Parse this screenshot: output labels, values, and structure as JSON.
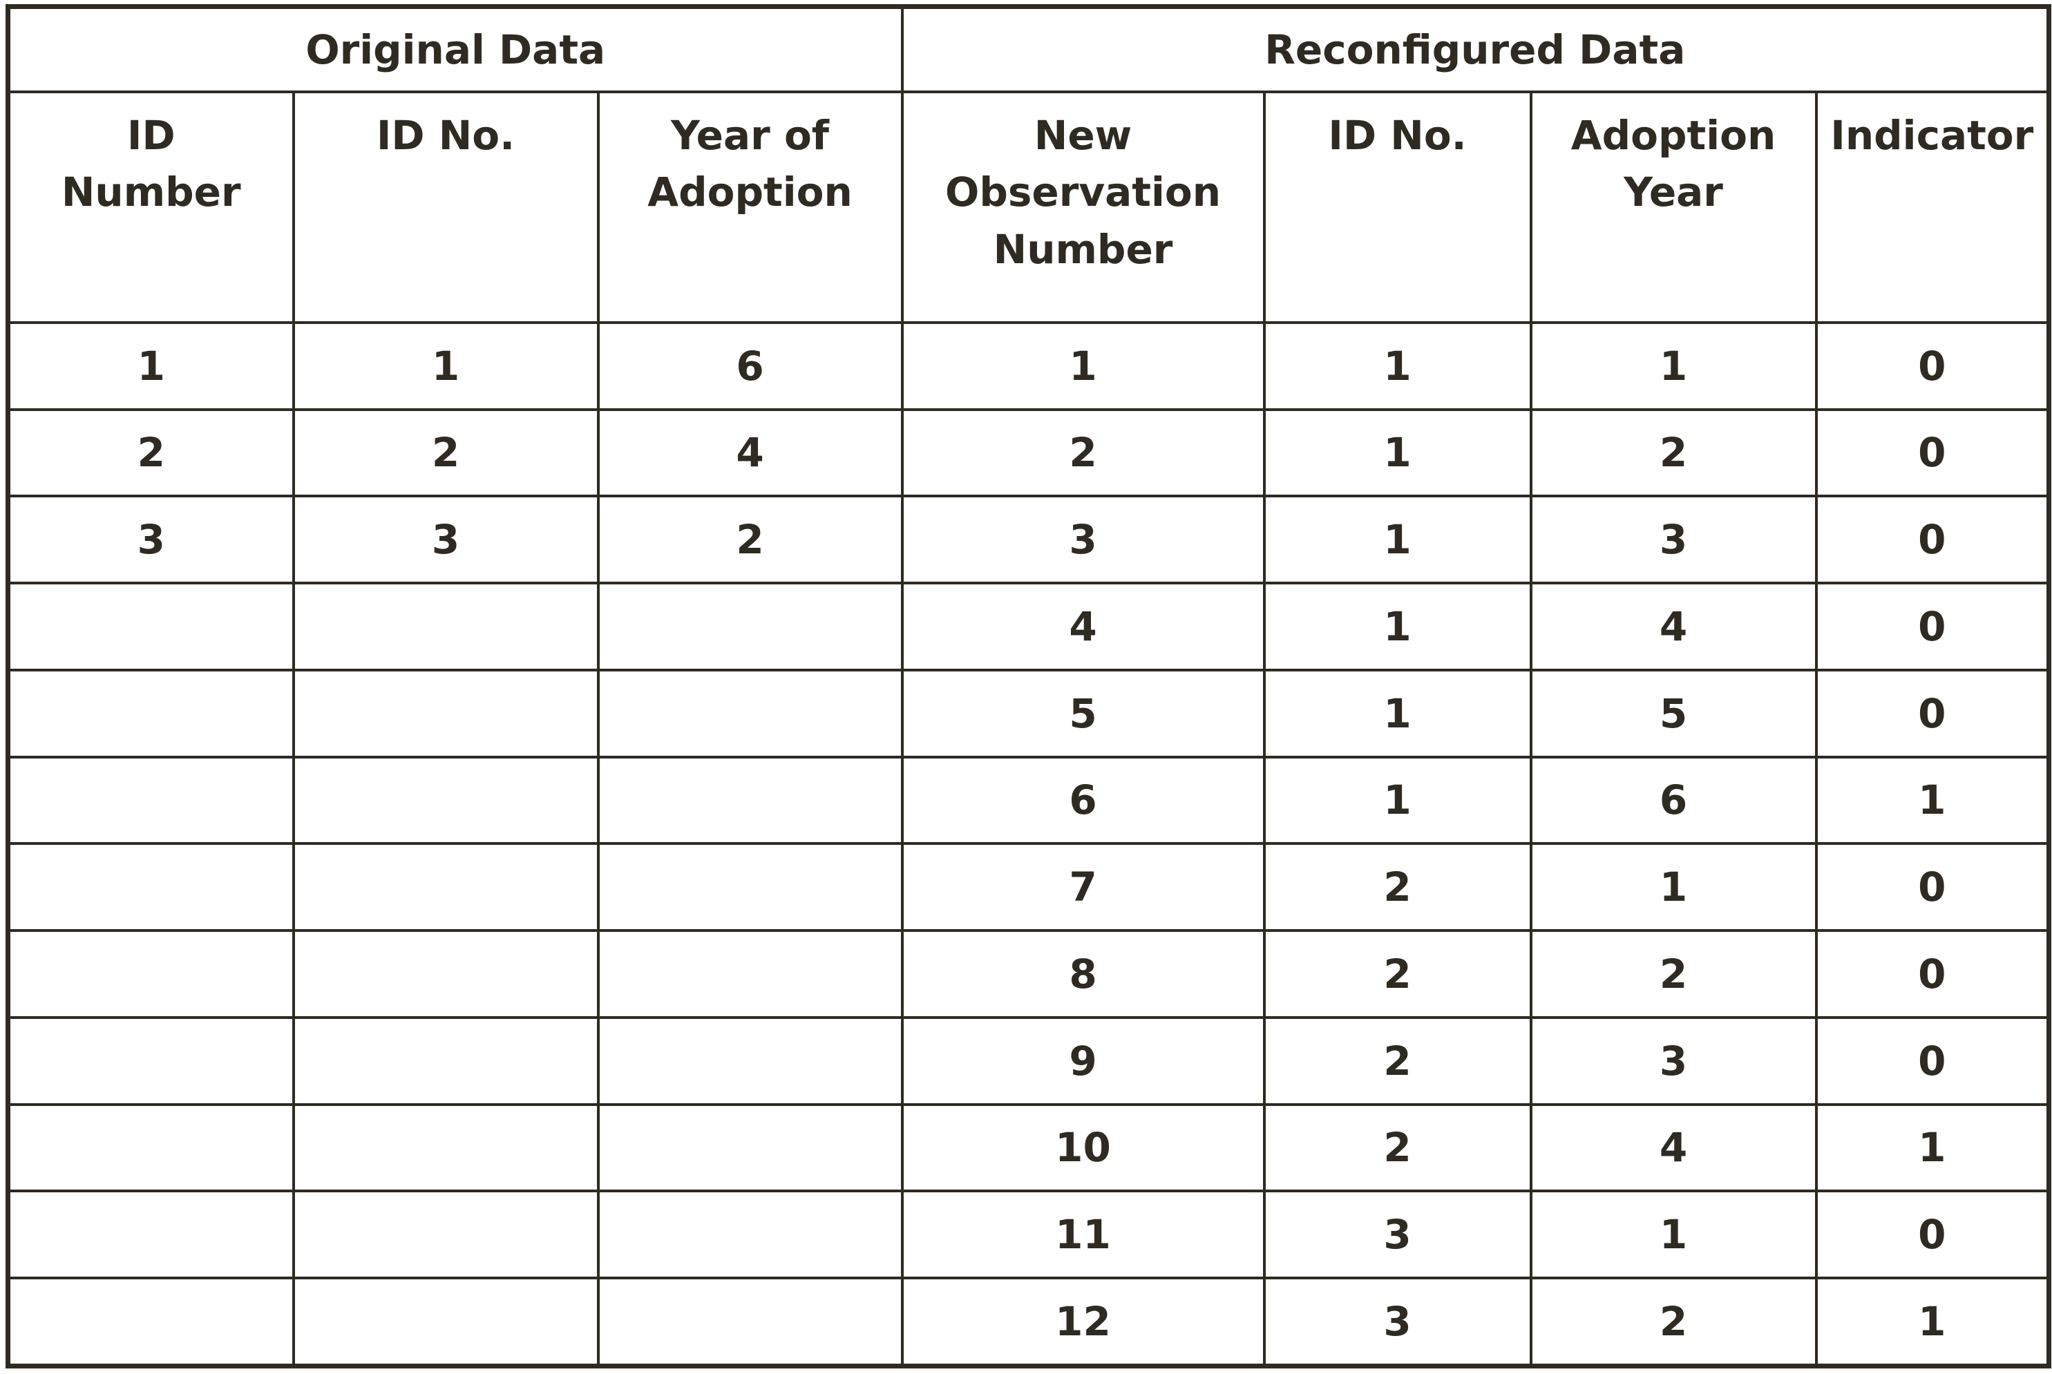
{
  "groups": {
    "original": "Original Data",
    "reconfigured": "Reconfigured Data"
  },
  "columns": {
    "id_number": [
      "ID",
      "Number"
    ],
    "id_no_original": [
      "ID No."
    ],
    "year_of_adoption": [
      "Year of",
      "Adoption"
    ],
    "new_observation_number": [
      "New",
      "Observation",
      "Number"
    ],
    "id_no_reconfigured": [
      "ID No."
    ],
    "adoption_year": [
      "Adoption",
      "Year"
    ],
    "indicator": [
      "Indicator"
    ]
  },
  "rows": [
    [
      "1",
      "1",
      "6",
      "1",
      "1",
      "1",
      "0"
    ],
    [
      "2",
      "2",
      "4",
      "2",
      "1",
      "2",
      "0"
    ],
    [
      "3",
      "3",
      "2",
      "3",
      "1",
      "3",
      "0"
    ],
    [
      "",
      "",
      "",
      "4",
      "1",
      "4",
      "0"
    ],
    [
      "",
      "",
      "",
      "5",
      "1",
      "5",
      "0"
    ],
    [
      "",
      "",
      "",
      "6",
      "1",
      "6",
      "1"
    ],
    [
      "",
      "",
      "",
      "7",
      "2",
      "1",
      "0"
    ],
    [
      "",
      "",
      "",
      "8",
      "2",
      "2",
      "0"
    ],
    [
      "",
      "",
      "",
      "9",
      "2",
      "3",
      "0"
    ],
    [
      "",
      "",
      "",
      "10",
      "2",
      "4",
      "1"
    ],
    [
      "",
      "",
      "",
      "11",
      "3",
      "1",
      "0"
    ],
    [
      "",
      "",
      "",
      "12",
      "3",
      "2",
      "1"
    ]
  ]
}
